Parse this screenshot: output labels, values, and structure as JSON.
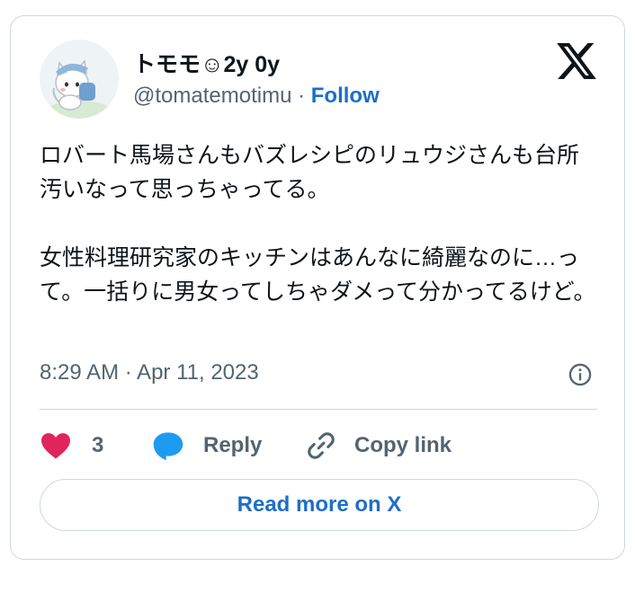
{
  "author": {
    "display_name": "トモモ☺2y 0y",
    "handle": "@tomatemotimu",
    "separator": "·",
    "follow_label": "Follow"
  },
  "tweet": {
    "paragraph_1": "ロバート馬場さんもバズレシピのリュウジさんも台所汚いなって思っちゃってる。",
    "paragraph_2": "女性料理研究家のキッチンはあんなに綺麗なのに…って。一括りに男女ってしちゃダメって分かってるけど。",
    "timestamp": "8:29 AM · Apr 11, 2023"
  },
  "actions": {
    "like_count": "3",
    "reply_label": "Reply",
    "copy_link_label": "Copy link"
  },
  "read_more_label": "Read more on X",
  "icons": {
    "logo": "x-logo-icon",
    "info": "info-icon",
    "like": "heart-icon",
    "reply": "speech-bubble-icon",
    "copy": "link-icon"
  },
  "colors": {
    "heart": "#e0245e",
    "reply_bubble": "#1d9bf0",
    "link_blue": "#1d6ec8",
    "muted_text": "#536471",
    "border": "#cfd9de"
  }
}
